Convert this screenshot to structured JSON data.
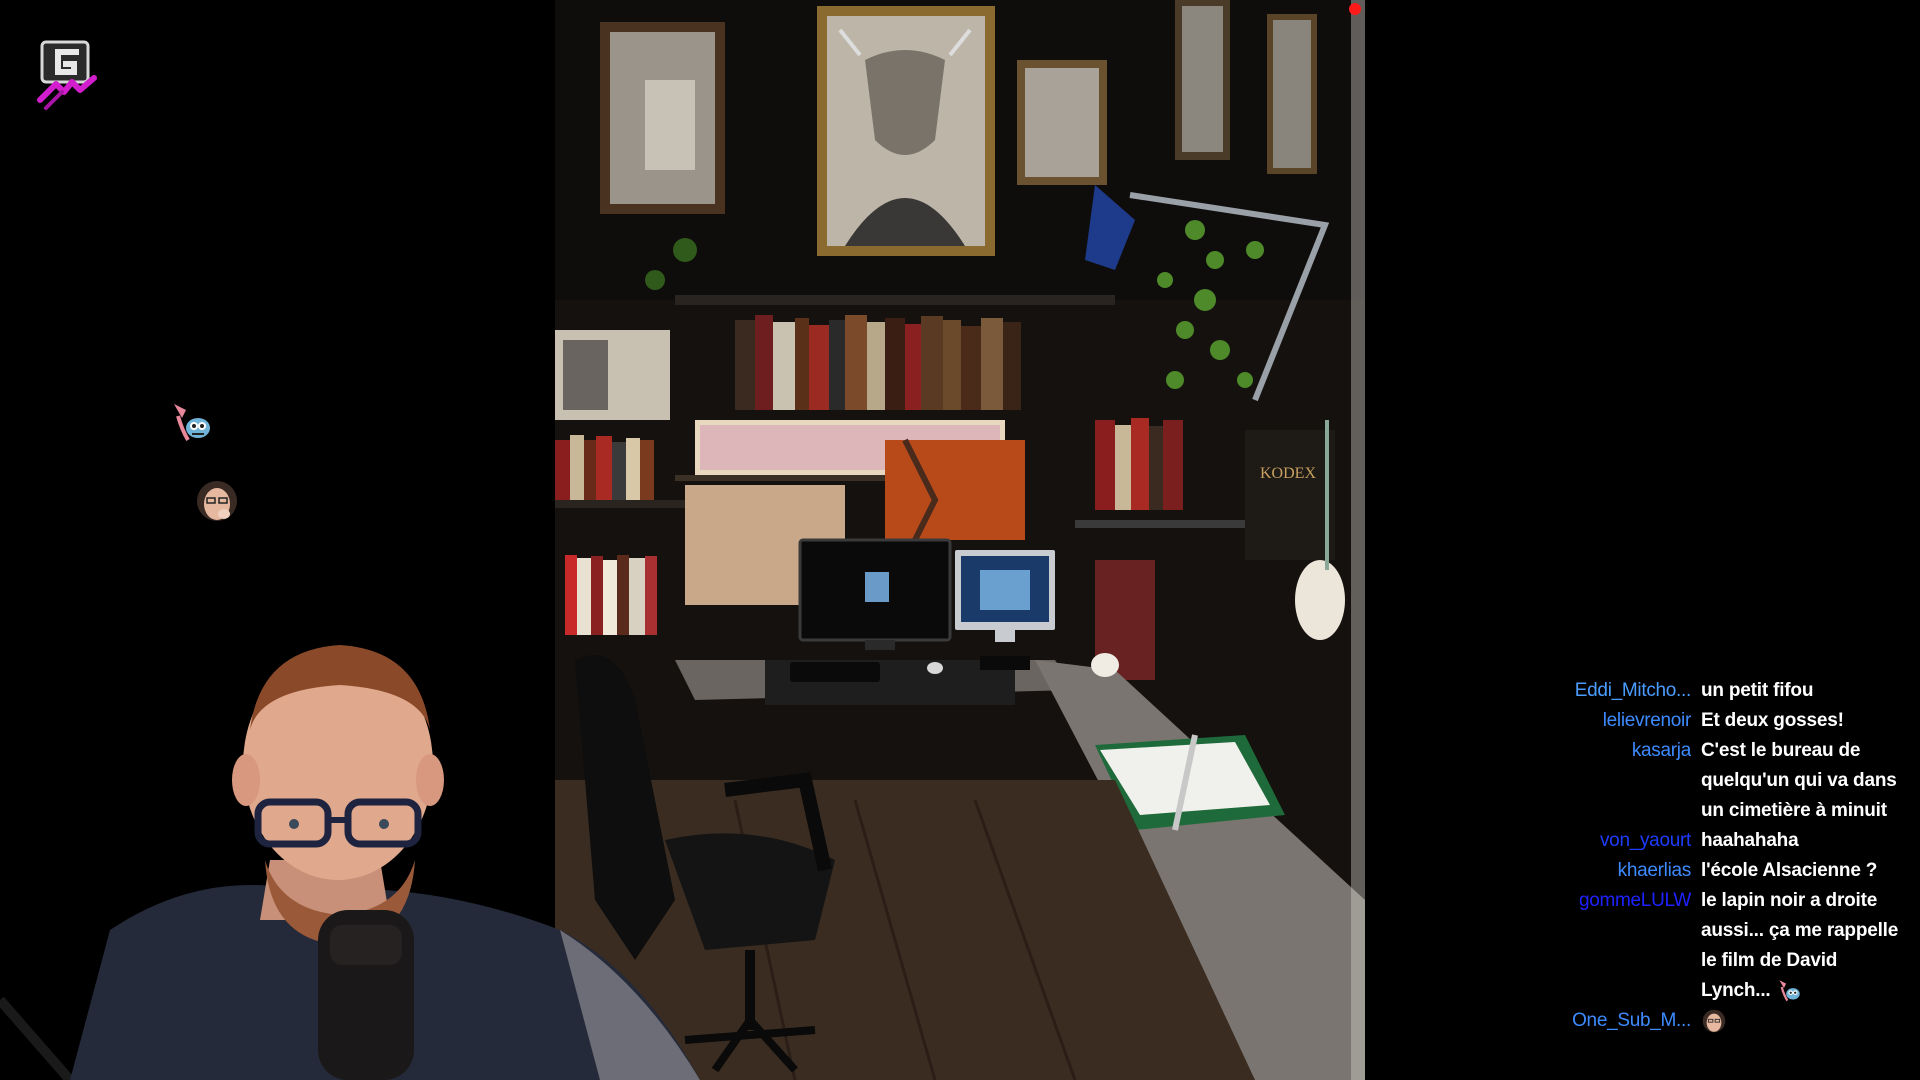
{
  "overlay": {
    "logo_icon": "channel-logo-g-tv",
    "recording_indicator_color": "#ff1a1a",
    "floating_emotes": [
      "bird-emote-icon",
      "face-emote-icon"
    ]
  },
  "scene": {
    "description_icon": "office-photo"
  },
  "chat": {
    "messages": [
      {
        "user": "Eddi_Mitcho...",
        "color": "#4a9cff",
        "text": "un petit fifou",
        "emote": ""
      },
      {
        "user": "lelievrenoir",
        "color": "#3d8bff",
        "text": "Et deux gosses!",
        "emote": ""
      },
      {
        "user": "kasarja",
        "color": "#3d8bff",
        "text": "C'est le bureau de quelqu'un qui va dans un cimetière à minuit",
        "emote": ""
      },
      {
        "user": "von_yaourt",
        "color": "#1e3cff",
        "text": "haahahaha",
        "emote": ""
      },
      {
        "user": "khaerlias",
        "color": "#3d8bff",
        "text": "l'école Alsacienne ?",
        "emote": ""
      },
      {
        "user": "gommeLULW",
        "color": "#1e22ff",
        "text": "le lapin noir a droite aussi... ça me rappelle le film de David Lynch...",
        "emote": "bird-emote-icon"
      },
      {
        "user": "One_Sub_M...",
        "color": "#3d8bff",
        "text": "",
        "emote": "face-emote-icon"
      }
    ]
  }
}
